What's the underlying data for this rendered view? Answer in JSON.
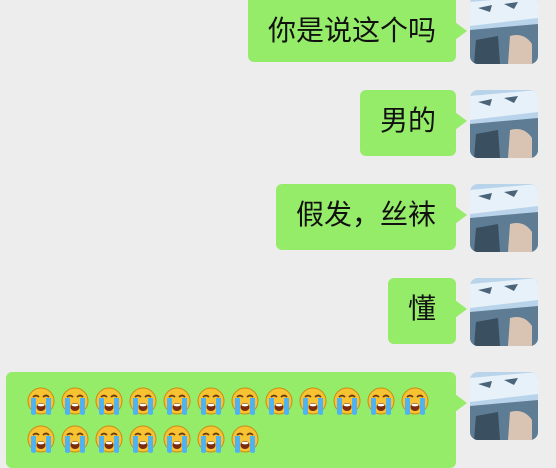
{
  "chat": {
    "messages": [
      {
        "text": "你是说这个吗"
      },
      {
        "text": "男的"
      },
      {
        "text": "假发，丝袜"
      },
      {
        "text": "懂"
      }
    ],
    "emoji_message": {
      "emoji_name": "loudly-crying-face-icon",
      "count": 19
    }
  },
  "colors": {
    "background": "#ededed",
    "bubble": "#95ec69"
  }
}
